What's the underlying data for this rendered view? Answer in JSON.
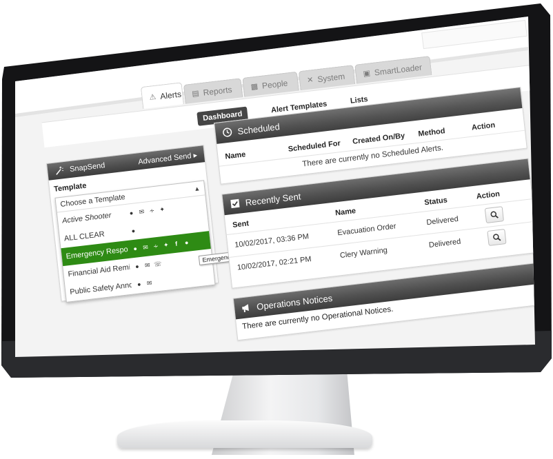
{
  "tabs": [
    {
      "label": "Alerts",
      "icon": "warning-icon",
      "active": true
    },
    {
      "label": "Reports",
      "icon": "report-icon",
      "active": false
    },
    {
      "label": "People",
      "icon": "people-icon",
      "active": false
    },
    {
      "label": "System",
      "icon": "tools-icon",
      "active": false
    },
    {
      "label": "SmartLoader",
      "icon": "loader-icon",
      "active": false
    }
  ],
  "subnav": {
    "dashboard": "Dashboard",
    "alert_templates": "Alert Templates",
    "lists": "Lists"
  },
  "snapsend": {
    "title": "SnapSend",
    "advanced_send": "Advanced Send",
    "template_label": "Template",
    "select_placeholder": "Choose a Template",
    "templates": [
      {
        "name": "Active Shooter",
        "icons": [
          "sms-icon",
          "email-icon",
          "rss-icon",
          "twitter-icon"
        ],
        "selected": false
      },
      {
        "name": "ALL CLEAR",
        "icons": [
          "voice-icon"
        ],
        "selected": false
      },
      {
        "name": "Emergency Respo...",
        "icons": [
          "sms-icon",
          "email-icon",
          "rss-icon",
          "twitter-icon",
          "facebook-icon",
          "voice-icon"
        ],
        "selected": true
      },
      {
        "name": "Financial Aid Remi...",
        "icons": [
          "sms-icon",
          "email-icon",
          "phone-icon"
        ],
        "selected": false
      },
      {
        "name": "Public Safety Anno...",
        "icons": [
          "sms-icon",
          "email-icon"
        ],
        "selected": false
      }
    ],
    "tooltip": "Emergency Response Team Alert"
  },
  "scheduled": {
    "title": "Scheduled",
    "columns": [
      "Name",
      "Scheduled For",
      "Created On/By",
      "Method",
      "Action"
    ],
    "empty": "There are currently no Scheduled Alerts."
  },
  "recently_sent": {
    "title": "Recently Sent",
    "columns": [
      "Sent",
      "Name",
      "Status",
      "Action"
    ],
    "rows": [
      {
        "sent": "10/02/2017, 03:36 PM",
        "name": "Evacuation Order",
        "status": "Delivered"
      },
      {
        "sent": "10/02/2017, 02:21 PM",
        "name": "Clery Warning",
        "status": "Delivered"
      }
    ]
  },
  "operations": {
    "title": "Operations Notices",
    "empty": "There are currently no Operational Notices."
  },
  "colors": {
    "accent_green": "#2e8b14",
    "header_dark": "#4a4a4a",
    "bezel": "#141416"
  }
}
